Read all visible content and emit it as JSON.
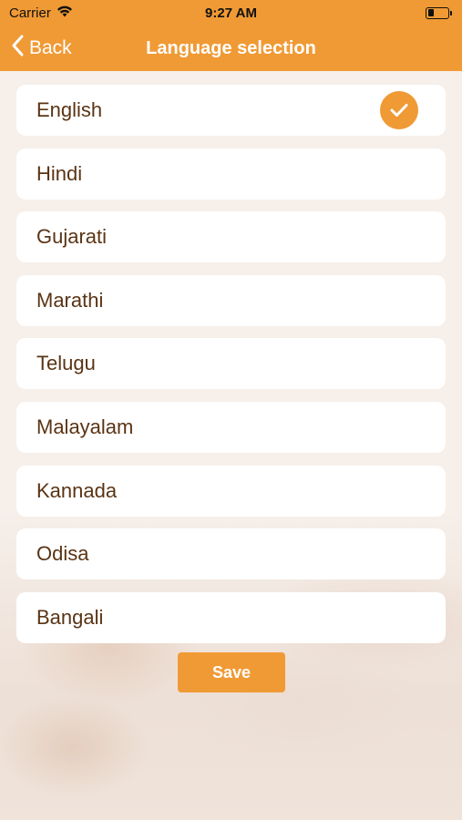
{
  "status": {
    "carrier": "Carrier",
    "time": "9:27 AM"
  },
  "nav": {
    "back_label": "Back",
    "title": "Language selection"
  },
  "languages": [
    {
      "label": "English",
      "selected": true
    },
    {
      "label": "Hindi",
      "selected": false
    },
    {
      "label": "Gujarati",
      "selected": false
    },
    {
      "label": "Marathi",
      "selected": false
    },
    {
      "label": "Telugu",
      "selected": false
    },
    {
      "label": "Malayalam",
      "selected": false
    },
    {
      "label": "Kannada",
      "selected": false
    },
    {
      "label": "Odisa",
      "selected": false
    },
    {
      "label": "Bangali",
      "selected": false
    }
  ],
  "save_label": "Save",
  "colors": {
    "accent": "#f09a35",
    "item_text": "#5a3414",
    "item_bg": "#ffffff"
  },
  "icons": {
    "wifi": "wifi-icon",
    "battery": "battery-icon",
    "back": "chevron-left-icon",
    "check": "checkmark-icon"
  }
}
